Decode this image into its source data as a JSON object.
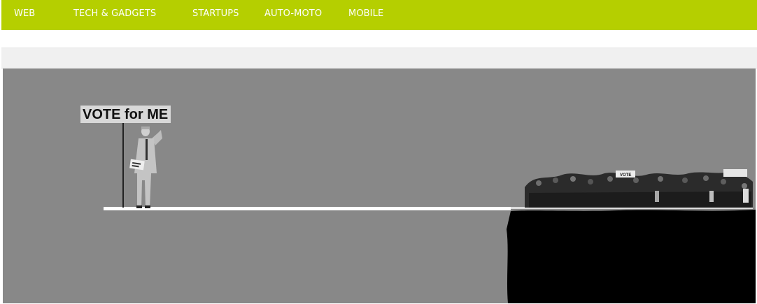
{
  "nav": {
    "items": [
      {
        "label": "WEB"
      },
      {
        "label": "TECH & GADGETS"
      },
      {
        "label": "STARTUPS"
      },
      {
        "label": "AUTO-MOTO"
      },
      {
        "label": "MOBILE"
      }
    ],
    "accent_color": "#b5cf00"
  },
  "hero": {
    "sign_text": "VOTE for ME",
    "crowd_sign_text": "VOTE",
    "background_color": "#888888",
    "cliff_color": "#000000"
  }
}
